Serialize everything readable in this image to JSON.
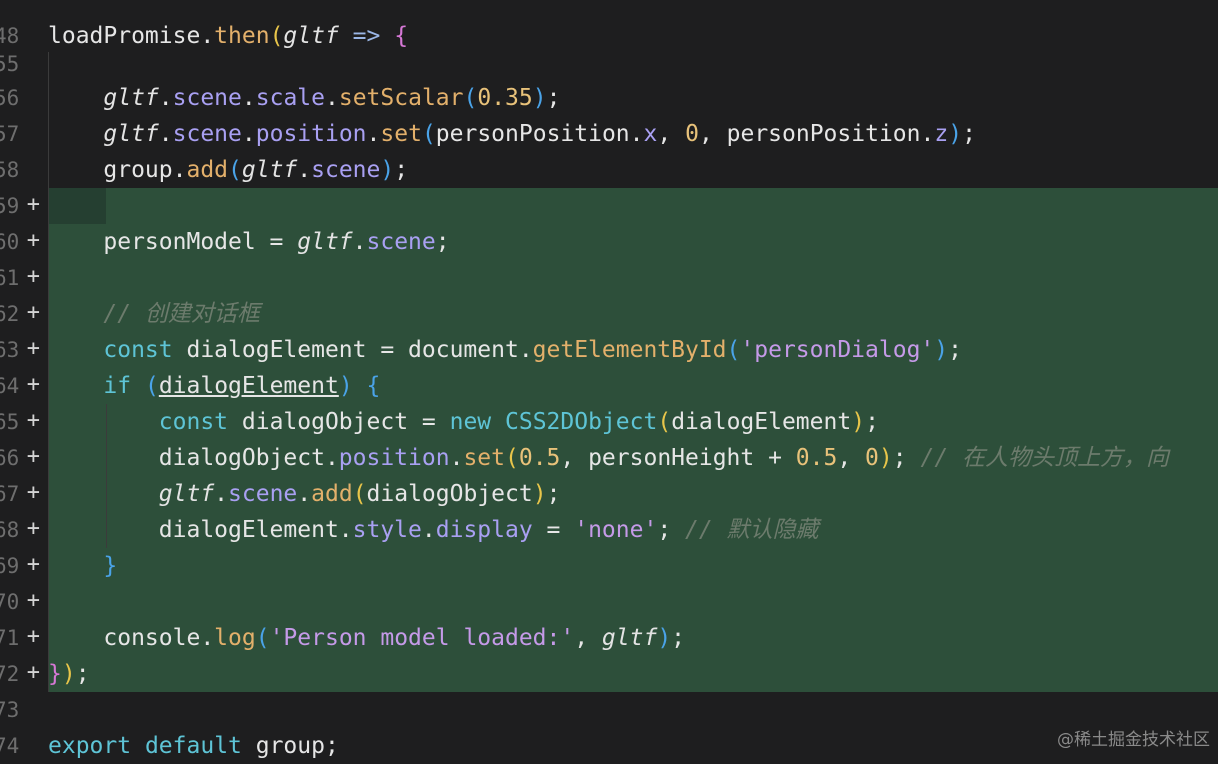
{
  "colors": {
    "background": "#1e1e1f",
    "added_line": "#2d4f3a",
    "line_number": "#6e6e6e"
  },
  "lines": [
    {
      "num": "48",
      "plus": "",
      "segments": [
        {
          "t": "loadPromise.",
          "c": ""
        },
        {
          "t": "then",
          "c": "fn"
        },
        {
          "t": "(",
          "c": "p1"
        },
        {
          "t": "gltf",
          "c": "param"
        },
        {
          "t": " => ",
          "c": "op"
        },
        {
          "t": "{",
          "c": "p2"
        }
      ]
    },
    {
      "num": "55",
      "plus": "",
      "segments": []
    },
    {
      "num": "56",
      "plus": "",
      "segments": [
        {
          "t": "    ",
          "c": ""
        },
        {
          "t": "gltf",
          "c": "param"
        },
        {
          "t": ".",
          "c": ""
        },
        {
          "t": "scene",
          "c": "prop"
        },
        {
          "t": ".",
          "c": ""
        },
        {
          "t": "scale",
          "c": "prop"
        },
        {
          "t": ".",
          "c": ""
        },
        {
          "t": "setScalar",
          "c": "fn"
        },
        {
          "t": "(",
          "c": "p3"
        },
        {
          "t": "0.35",
          "c": "num"
        },
        {
          "t": ")",
          "c": "p3"
        },
        {
          "t": ";",
          "c": ""
        }
      ]
    },
    {
      "num": "57",
      "plus": "",
      "segments": [
        {
          "t": "    ",
          "c": ""
        },
        {
          "t": "gltf",
          "c": "param"
        },
        {
          "t": ".",
          "c": ""
        },
        {
          "t": "scene",
          "c": "prop"
        },
        {
          "t": ".",
          "c": ""
        },
        {
          "t": "position",
          "c": "prop"
        },
        {
          "t": ".",
          "c": ""
        },
        {
          "t": "set",
          "c": "fn"
        },
        {
          "t": "(",
          "c": "p3"
        },
        {
          "t": "personPosition.",
          "c": ""
        },
        {
          "t": "x",
          "c": "prop"
        },
        {
          "t": ", ",
          "c": ""
        },
        {
          "t": "0",
          "c": "num"
        },
        {
          "t": ", personPosition.",
          "c": ""
        },
        {
          "t": "z",
          "c": "prop"
        },
        {
          "t": ")",
          "c": "p3"
        },
        {
          "t": ";",
          "c": ""
        }
      ]
    },
    {
      "num": "58",
      "plus": "",
      "segments": [
        {
          "t": "    group.",
          "c": ""
        },
        {
          "t": "add",
          "c": "fn"
        },
        {
          "t": "(",
          "c": "p3"
        },
        {
          "t": "gltf",
          "c": "param"
        },
        {
          "t": ".",
          "c": ""
        },
        {
          "t": "scene",
          "c": "prop"
        },
        {
          "t": ")",
          "c": "p3"
        },
        {
          "t": ";",
          "c": ""
        }
      ]
    },
    {
      "num": "59",
      "plus": "+",
      "segments": []
    },
    {
      "num": "60",
      "plus": "+",
      "segments": [
        {
          "t": "    personModel = ",
          "c": ""
        },
        {
          "t": "gltf",
          "c": "param"
        },
        {
          "t": ".",
          "c": ""
        },
        {
          "t": "scene",
          "c": "prop"
        },
        {
          "t": ";",
          "c": ""
        }
      ]
    },
    {
      "num": "61",
      "plus": "+",
      "segments": []
    },
    {
      "num": "62",
      "plus": "+",
      "segments": [
        {
          "t": "    ",
          "c": ""
        },
        {
          "t": "// 创建对话框",
          "c": "cmt"
        }
      ]
    },
    {
      "num": "63",
      "plus": "+",
      "segments": [
        {
          "t": "    ",
          "c": ""
        },
        {
          "t": "const",
          "c": "kw"
        },
        {
          "t": " dialogElement = document.",
          "c": ""
        },
        {
          "t": "getElementById",
          "c": "fn"
        },
        {
          "t": "(",
          "c": "p3"
        },
        {
          "t": "'personDialog'",
          "c": "str"
        },
        {
          "t": ")",
          "c": "p3"
        },
        {
          "t": ";",
          "c": ""
        }
      ]
    },
    {
      "num": "64",
      "plus": "+",
      "segments": [
        {
          "t": "    ",
          "c": ""
        },
        {
          "t": "if",
          "c": "kw"
        },
        {
          "t": " ",
          "c": ""
        },
        {
          "t": "(",
          "c": "p3"
        },
        {
          "t": "dialogElement",
          "c": "und"
        },
        {
          "t": ")",
          "c": "p3"
        },
        {
          "t": " ",
          "c": ""
        },
        {
          "t": "{",
          "c": "p3"
        }
      ]
    },
    {
      "num": "65",
      "plus": "+",
      "segments": [
        {
          "t": "        ",
          "c": ""
        },
        {
          "t": "const",
          "c": "kw"
        },
        {
          "t": " dialogObject = ",
          "c": ""
        },
        {
          "t": "new",
          "c": "kw"
        },
        {
          "t": " ",
          "c": ""
        },
        {
          "t": "CSS2DObject",
          "c": "cls"
        },
        {
          "t": "(",
          "c": "p1"
        },
        {
          "t": "dialogElement",
          "c": ""
        },
        {
          "t": ")",
          "c": "p1"
        },
        {
          "t": ";",
          "c": ""
        }
      ]
    },
    {
      "num": "66",
      "plus": "+",
      "segments": [
        {
          "t": "        dialogObject.",
          "c": ""
        },
        {
          "t": "position",
          "c": "prop"
        },
        {
          "t": ".",
          "c": ""
        },
        {
          "t": "set",
          "c": "fn"
        },
        {
          "t": "(",
          "c": "p1"
        },
        {
          "t": "0.5",
          "c": "num"
        },
        {
          "t": ", personHeight + ",
          "c": ""
        },
        {
          "t": "0.5",
          "c": "num"
        },
        {
          "t": ", ",
          "c": ""
        },
        {
          "t": "0",
          "c": "num"
        },
        {
          "t": ")",
          "c": "p1"
        },
        {
          "t": "; ",
          "c": ""
        },
        {
          "t": "// 在人物头顶上方，向",
          "c": "cmt"
        }
      ]
    },
    {
      "num": "67",
      "plus": "+",
      "segments": [
        {
          "t": "        ",
          "c": ""
        },
        {
          "t": "gltf",
          "c": "param"
        },
        {
          "t": ".",
          "c": ""
        },
        {
          "t": "scene",
          "c": "prop"
        },
        {
          "t": ".",
          "c": ""
        },
        {
          "t": "add",
          "c": "fn"
        },
        {
          "t": "(",
          "c": "p1"
        },
        {
          "t": "dialogObject",
          "c": ""
        },
        {
          "t": ")",
          "c": "p1"
        },
        {
          "t": ";",
          "c": ""
        }
      ]
    },
    {
      "num": "68",
      "plus": "+",
      "segments": [
        {
          "t": "        dialogElement.",
          "c": ""
        },
        {
          "t": "style",
          "c": "prop"
        },
        {
          "t": ".",
          "c": ""
        },
        {
          "t": "display",
          "c": "prop"
        },
        {
          "t": " = ",
          "c": ""
        },
        {
          "t": "'none'",
          "c": "str"
        },
        {
          "t": "; ",
          "c": ""
        },
        {
          "t": "// 默认隐藏",
          "c": "cmt"
        }
      ]
    },
    {
      "num": "69",
      "plus": "+",
      "segments": [
        {
          "t": "    ",
          "c": ""
        },
        {
          "t": "}",
          "c": "p3"
        }
      ]
    },
    {
      "num": "70",
      "plus": "+",
      "segments": []
    },
    {
      "num": "71",
      "plus": "+",
      "segments": [
        {
          "t": "    console.",
          "c": ""
        },
        {
          "t": "log",
          "c": "fn"
        },
        {
          "t": "(",
          "c": "p3"
        },
        {
          "t": "'Person model loaded:'",
          "c": "str"
        },
        {
          "t": ", ",
          "c": ""
        },
        {
          "t": "gltf",
          "c": "param"
        },
        {
          "t": ")",
          "c": "p3"
        },
        {
          "t": ";",
          "c": ""
        }
      ]
    },
    {
      "num": "72",
      "plus": "+",
      "segments": [
        {
          "t": "}",
          "c": "p2"
        },
        {
          "t": ")",
          "c": "p1"
        },
        {
          "t": ";",
          "c": ""
        }
      ]
    },
    {
      "num": "73",
      "plus": "",
      "segments": []
    },
    {
      "num": "74",
      "plus": "",
      "segments": [
        {
          "t": "export",
          "c": "kw"
        },
        {
          "t": " ",
          "c": ""
        },
        {
          "t": "default",
          "c": "kw"
        },
        {
          "t": " group;",
          "c": ""
        }
      ]
    }
  ],
  "watermark": "@稀土掘金技术社区"
}
